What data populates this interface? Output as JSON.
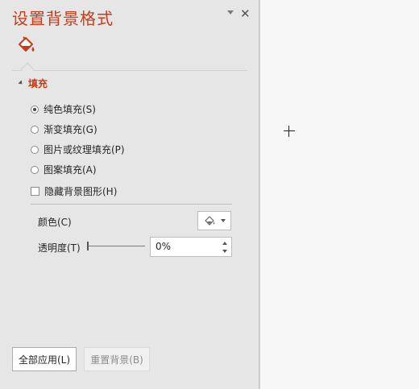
{
  "pane": {
    "title": "设置背景格式",
    "menu_icon": "chevron-down-icon",
    "close_icon": "close-icon",
    "close_glyph": "✕",
    "tab_icon": "paint-bucket-icon"
  },
  "fill": {
    "section_label": "填充",
    "options": [
      {
        "label": "纯色填充(S)",
        "selected": true
      },
      {
        "label": "渐变填充(G)",
        "selected": false
      },
      {
        "label": "图片或纹理填充(P)",
        "selected": false
      },
      {
        "label": "图案填充(A)",
        "selected": false
      }
    ],
    "hide_bg_graphics": {
      "label": "隐藏背景图形(H)",
      "checked": false
    },
    "color": {
      "label": "颜色(C)",
      "icon": "paint-bucket-icon"
    },
    "transparency": {
      "label": "透明度(T)",
      "value": "0%",
      "slider_fraction": 0
    }
  },
  "footer": {
    "apply_all": "全部应用(L)",
    "reset_bg": "重置背景(B)"
  },
  "colors": {
    "accent": "#c43e1c",
    "pane_bg": "#e6e6e6"
  }
}
